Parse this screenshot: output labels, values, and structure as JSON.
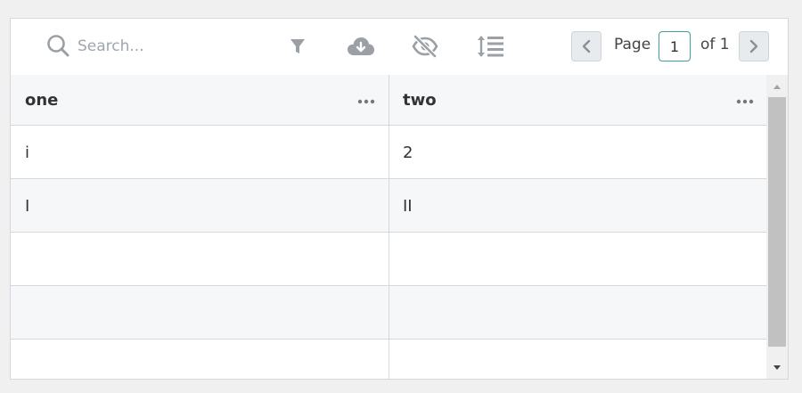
{
  "toolbar": {
    "search_placeholder": "Search...",
    "search_value": "",
    "icons": [
      "search-icon",
      "filter-icon",
      "download-icon",
      "hide-columns-icon",
      "row-density-icon"
    ],
    "pagination": {
      "page_label": "Page",
      "current_page": "1",
      "of_label": "of 1"
    }
  },
  "table": {
    "columns": [
      {
        "label": "one"
      },
      {
        "label": "two"
      }
    ],
    "rows": [
      [
        "i",
        "2"
      ],
      [
        "I",
        "II"
      ],
      [
        "",
        ""
      ],
      [
        "",
        ""
      ],
      [
        "",
        ""
      ]
    ]
  },
  "colors": {
    "accent": "#3aa3a0",
    "icon": "#9aa0a6",
    "header_bg": "#f5f7f9",
    "border": "#d4d8dd"
  }
}
